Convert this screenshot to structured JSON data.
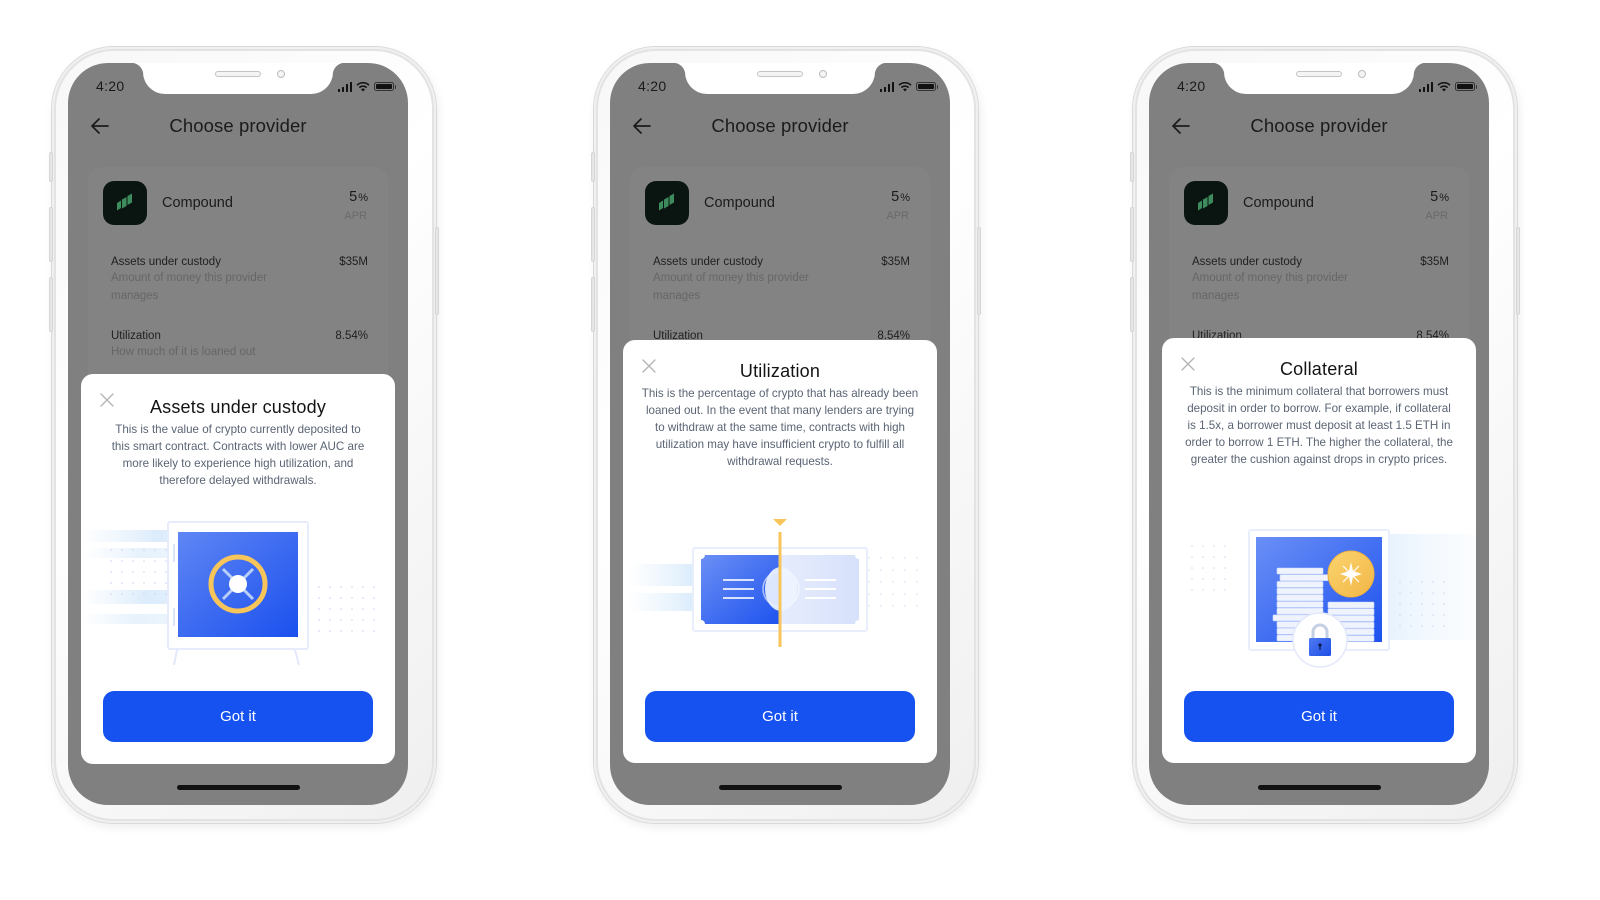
{
  "status_bar": {
    "time": "4:20"
  },
  "nav": {
    "title": "Choose provider"
  },
  "provider": {
    "name": "Compound",
    "apr_value": "5",
    "apr_unit": "%",
    "apr_label": "APR",
    "logo_color": "#3e8b5e"
  },
  "stats": [
    {
      "label": "Assets under custody",
      "desc": "Amount of money this provider manages",
      "value": "$35M"
    },
    {
      "label": "Utilization",
      "desc": "How much of it is loaned out",
      "value": "8.54%"
    }
  ],
  "sheets": [
    {
      "title": "Assets under custody",
      "body": "This is the value of crypto currently deposited to this smart contract. Contracts with lower AUC are more likely to experience high utilization, and therefore delayed withdrawals.",
      "button": "Got it",
      "illustration": "vault"
    },
    {
      "title": "Utilization",
      "body": "This is the percentage of crypto that has already been loaned out. In the event that many lenders are trying to withdraw at the same time, contracts with high utilization may have insufficient crypto to fulfill all withdrawal requests.",
      "button": "Got it",
      "illustration": "banknote-split"
    },
    {
      "title": "Collateral",
      "body": "This is the minimum collateral that borrowers must deposit in order to borrow. For example, if collateral is 1.5x, a borrower must deposit at least 1.5 ETH in order to borrow 1 ETH. The higher the collateral, the greater the cushion against drops in crypto prices.",
      "button": "Got it",
      "illustration": "coin-stacks-lock"
    }
  ],
  "colors": {
    "primary": "#1652f0",
    "overlay": "#808080",
    "accent_gold": "#f7c55a",
    "illustration_blue": "#3e6ff0"
  }
}
